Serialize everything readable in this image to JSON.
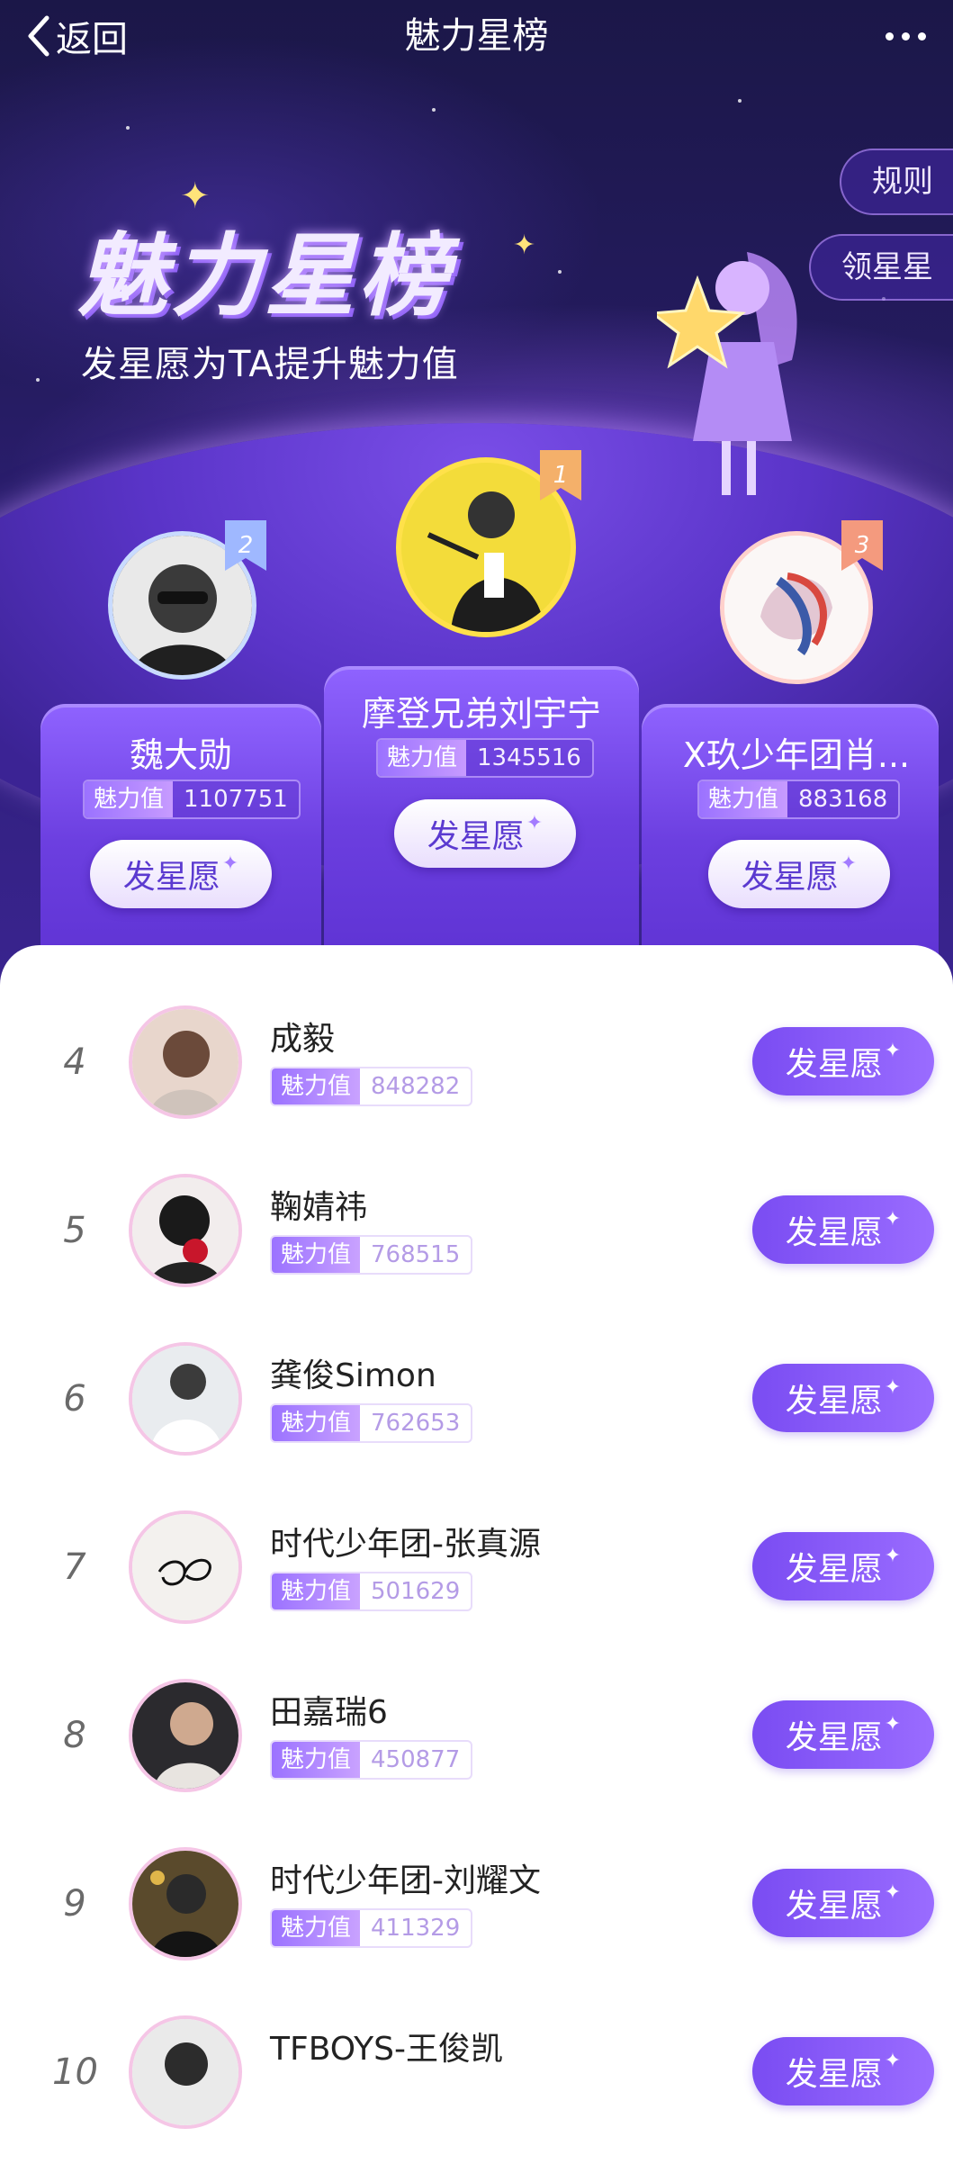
{
  "nav": {
    "back_label": "返回",
    "title": "魅力星榜"
  },
  "side": {
    "rules": "规则",
    "claim_stars": "领星星"
  },
  "hero": {
    "title": "魅力星榜",
    "subtitle": "发星愿为TA提升魅力值"
  },
  "charm_label": "魅力值",
  "wish_label": "发星愿",
  "top3": [
    {
      "rank": "2",
      "name": "魏大勋",
      "value": "1107751"
    },
    {
      "rank": "1",
      "name": "摩登兄弟刘宇宁",
      "value": "1345516"
    },
    {
      "rank": "3",
      "name": "X玖少年团肖...",
      "value": "883168"
    }
  ],
  "list": [
    {
      "rank": "4",
      "name": "成毅",
      "value": "848282"
    },
    {
      "rank": "5",
      "name": "鞠婧祎",
      "value": "768515"
    },
    {
      "rank": "6",
      "name": "龚俊Simon",
      "value": "762653"
    },
    {
      "rank": "7",
      "name": "时代少年团-张真源",
      "value": "501629"
    },
    {
      "rank": "8",
      "name": "田嘉瑞6",
      "value": "450877"
    },
    {
      "rank": "9",
      "name": "时代少年团-刘耀文",
      "value": "411329"
    },
    {
      "rank": "10",
      "name": "TFBOYS-王俊凯",
      "value": ""
    }
  ],
  "colors": {
    "accent": "#7a4cf2",
    "hero_bg": "#241b5e",
    "rank_ribbon": "#f4b06a"
  }
}
